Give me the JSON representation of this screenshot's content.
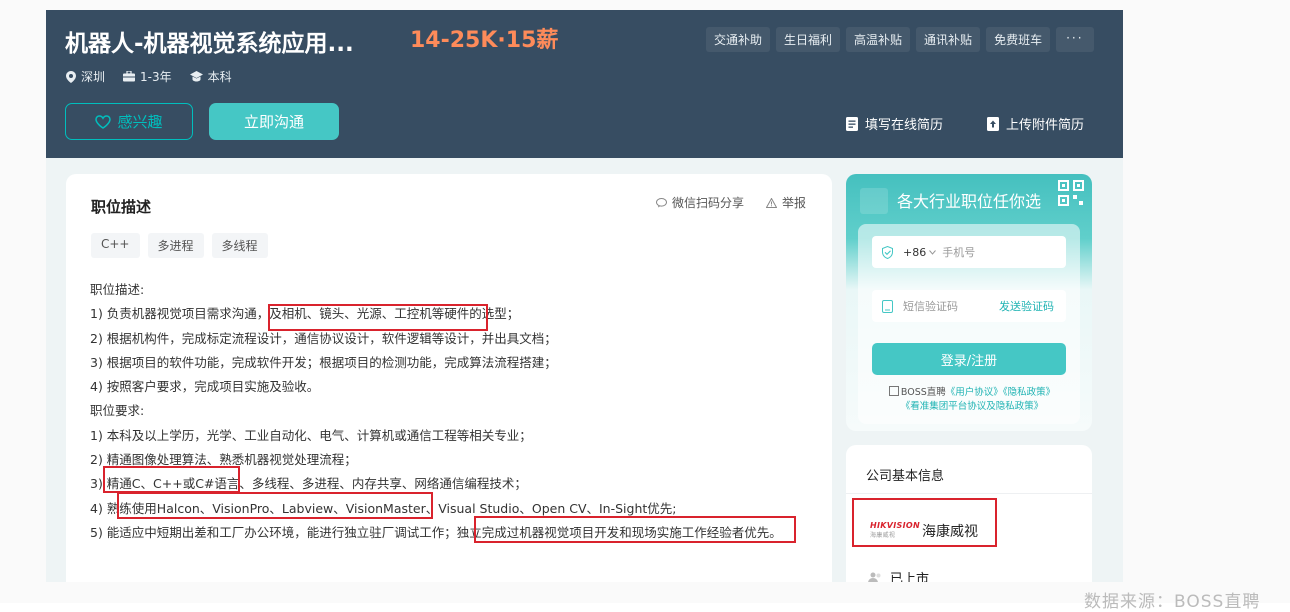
{
  "header": {
    "job_title": "机器人-机器视觉系统应用...",
    "salary": "14-25K·15薪",
    "benefits": [
      "交通补助",
      "生日福利",
      "高温补贴",
      "通讯补贴",
      "免费班车"
    ],
    "benefit_more": "···",
    "meta": {
      "city": "深圳",
      "experience": "1-3年",
      "education": "本科"
    },
    "interest_label": "感兴趣",
    "chat_label": "立即沟通",
    "resume_online_label": "填写在线简历",
    "resume_upload_label": "上传附件简历"
  },
  "description": {
    "title": "职位描述",
    "share_label": "微信扫码分享",
    "report_label": "举报",
    "tags": [
      "C++",
      "多进程",
      "多线程"
    ],
    "lines": [
      "职位描述:",
      "1) 负责机器视觉项目需求沟通，及相机、镜头、光源、工控机等硬件的选型；",
      "2) 根据机构件，完成标定流程设计，通信协议设计，软件逻辑等设计，并出具文档；",
      "3) 根据项目的软件功能，完成软件开发；根据项目的检测功能，完成算法流程搭建；",
      "4) 按照客户要求，完成项目实施及验收。",
      "职位要求:",
      "1) 本科及以上学历，光学、工业自动化、电气、计算机或通信工程等相关专业；",
      "2) 精通图像处理算法、熟悉机器视觉处理流程；",
      "3) 精通C、C++或C#语言、多线程、多进程、内存共享、网络通信编程技术；",
      "4) 熟练使用Halcon、VisionPro、Labview、VisionMaster、Visual Studio、Open CV、In-Sight优先;",
      "5) 能适应中短期出差和工厂办公环境，能进行独立驻厂调试工作；独立完成过机器视觉项目开发和现场实施工作经验者优先。"
    ]
  },
  "login": {
    "header": "各大行业职位任你选",
    "country_code": "+86",
    "phone_placeholder": "手机号",
    "sms_placeholder": "短信验证码",
    "send_code": "发送验证码",
    "login_button": "登录/注册",
    "agree_prefix": "BOSS直聘",
    "user_agreement": "《用户协议》",
    "privacy_policy": "《隐私政策》",
    "group_policy": "《看准集团平台协议及隐私政策》"
  },
  "company": {
    "header": "公司基本信息",
    "logo_text": "HIKVISION",
    "logo_sub": "海康威视",
    "name": "海康威视",
    "status": "已上市"
  },
  "watermark": "数据来源：BOSS直聘",
  "colors": {
    "header_bg": "#374d62",
    "accent": "#00bebd",
    "salary": "#fe8b5a",
    "highlight_box": "#d9232d"
  }
}
